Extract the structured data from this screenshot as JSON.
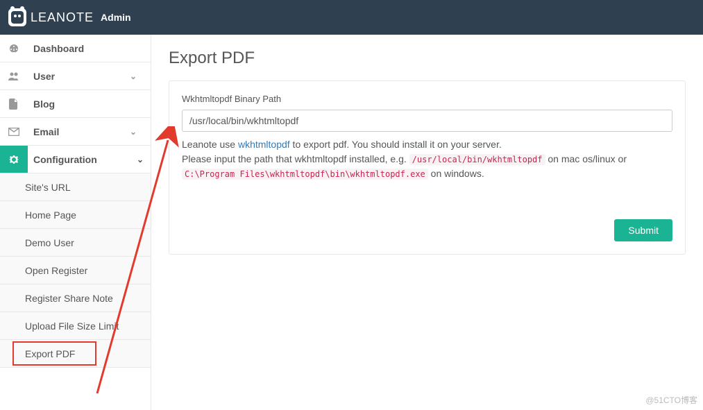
{
  "brand": {
    "name": "LEANOTE",
    "sub": "Admin"
  },
  "sidebar": {
    "items": [
      {
        "label": "Dashboard"
      },
      {
        "label": "User"
      },
      {
        "label": "Blog"
      },
      {
        "label": "Email"
      },
      {
        "label": "Configuration"
      }
    ],
    "config_children": [
      "Site's URL",
      "Home Page",
      "Demo User",
      "Open Register",
      "Register Share Note",
      "Upload File Size Limit",
      "Export PDF"
    ]
  },
  "page": {
    "title": "Export PDF",
    "field_label": "Wkhtmltopdf Binary Path",
    "field_value": "/usr/local/bin/wkhtmltopdf",
    "help_1a": "Leanote use ",
    "help_1_link": "wkhtmltopdf",
    "help_1b": " to export pdf. You should install it on your server.",
    "help_2a": "Please input the path that wkhtmltopdf installed, e.g. ",
    "help_2_code1": "/usr/local/bin/wkhtmltopdf",
    "help_2b": " on mac os/linux or ",
    "help_2_code2": "C:\\Program Files\\wkhtmltopdf\\bin\\wkhtmltopdf.exe",
    "help_2c": " on windows.",
    "submit": "Submit"
  },
  "watermark": "@51CTO博客"
}
